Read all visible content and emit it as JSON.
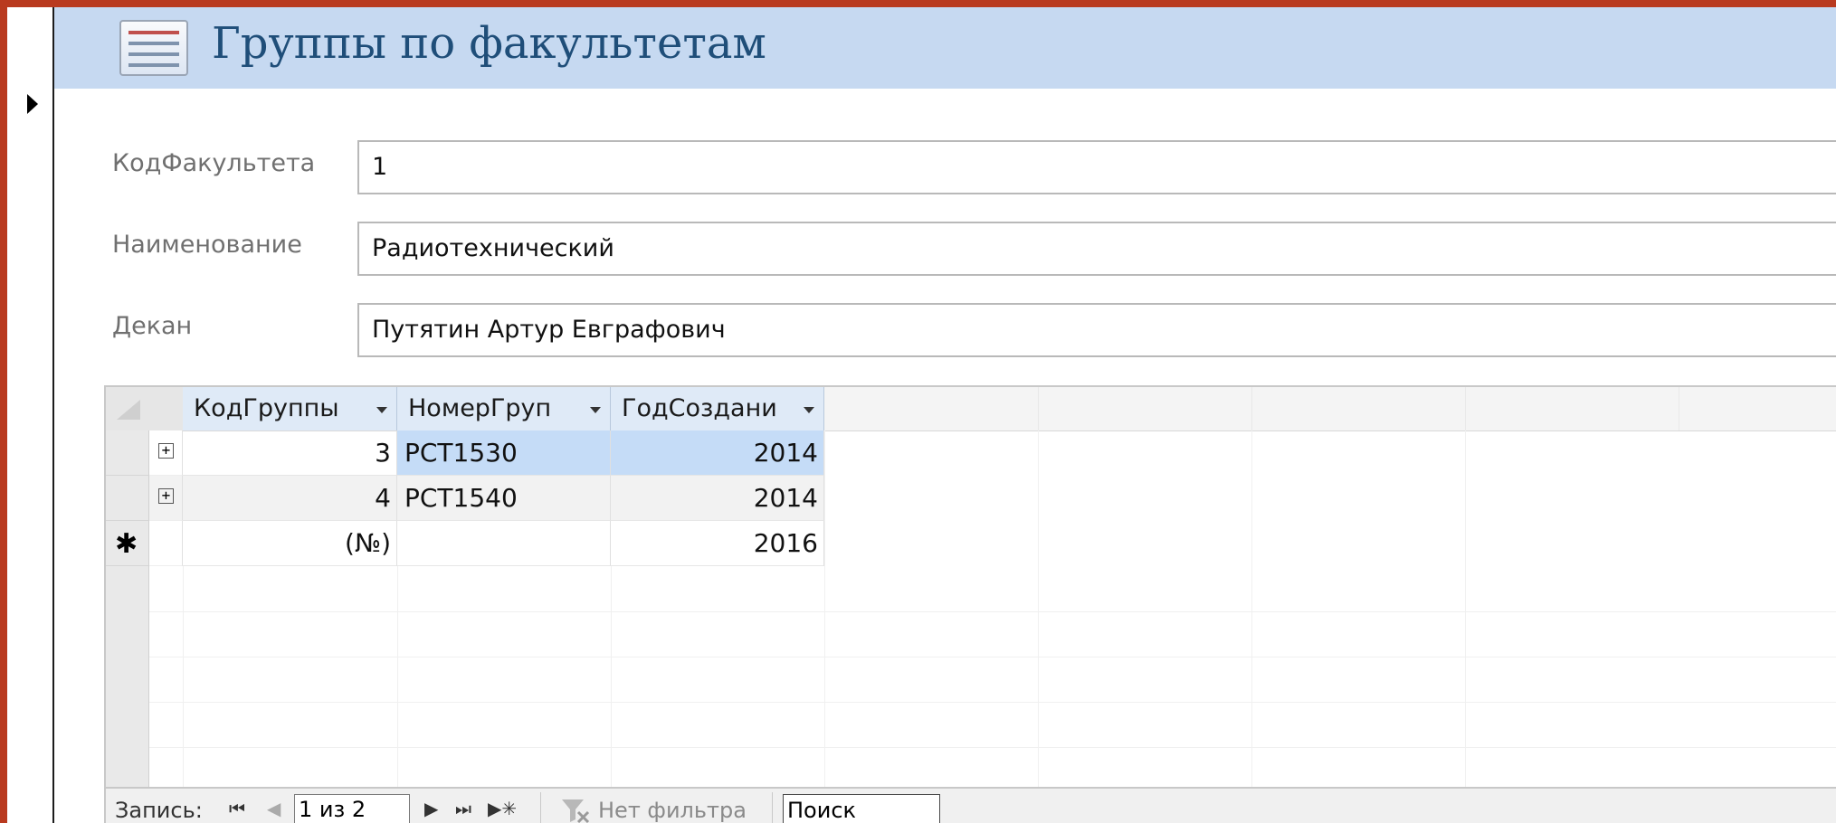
{
  "form": {
    "title": "Группы по факультетам",
    "icon": "form-icon"
  },
  "fields": [
    {
      "label": "КодФакультета",
      "value": "1"
    },
    {
      "label": "Наименование",
      "value": "Радиотехнический"
    },
    {
      "label": "Декан",
      "value": "Путятин Артур Евграфович"
    }
  ],
  "subform": {
    "columns": [
      {
        "label": "КодГруппы"
      },
      {
        "label": "НомерГруп"
      },
      {
        "label": "ГодСоздани"
      }
    ],
    "rows": [
      {
        "kod": "3",
        "nomer": "PCT1530",
        "god": "2014",
        "selected": true
      },
      {
        "kod": "4",
        "nomer": "PCT1540",
        "god": "2014",
        "selected": false
      }
    ],
    "new_row": {
      "kod": "(№)",
      "nomer": "",
      "god": "2016"
    }
  },
  "navigator": {
    "record_label": "Запись:",
    "record_position": "1 из 2",
    "filter_label": "Нет фильтра",
    "search_value": "Поиск"
  },
  "colors": {
    "header_bg": "#c6d9f1",
    "title": "#1f4e79",
    "window_border": "#b93a1f",
    "selected_cell": "#c5dcf7"
  }
}
